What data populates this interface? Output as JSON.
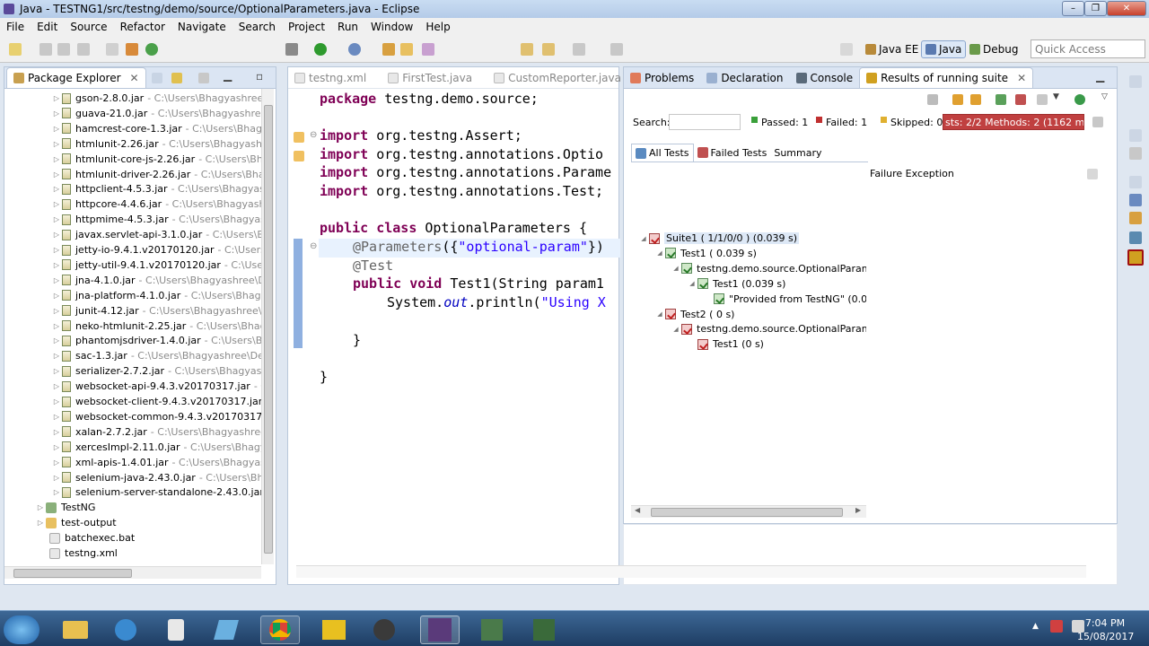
{
  "window": {
    "title": "Java - TESTNG1/src/testng/demo/source/OptionalParameters.java - Eclipse"
  },
  "menu": [
    "File",
    "Edit",
    "Source",
    "Refactor",
    "Navigate",
    "Search",
    "Project",
    "Run",
    "Window",
    "Help"
  ],
  "perspectives": {
    "java_ee": "Java EE",
    "java": "Java",
    "debug": "Debug"
  },
  "quick_access": {
    "placeholder": "Quick Access"
  },
  "package_explorer": {
    "title": "Package Explorer",
    "jars": [
      {
        "name": "gson-2.8.0.jar",
        "path": "- C:\\Users\\Bhagyashree\\De"
      },
      {
        "name": "guava-21.0.jar",
        "path": "- C:\\Users\\Bhagyashree\\D"
      },
      {
        "name": "hamcrest-core-1.3.jar",
        "path": "- C:\\Users\\Bhagya"
      },
      {
        "name": "htmlunit-2.26.jar",
        "path": "- C:\\Users\\Bhagyashree"
      },
      {
        "name": "htmlunit-core-js-2.26.jar",
        "path": "- C:\\Users\\Bhag"
      },
      {
        "name": "htmlunit-driver-2.26.jar",
        "path": "- C:\\Users\\Bhagy"
      },
      {
        "name": "httpclient-4.5.3.jar",
        "path": "- C:\\Users\\Bhagyashr"
      },
      {
        "name": "httpcore-4.4.6.jar",
        "path": "- C:\\Users\\Bhagyashree"
      },
      {
        "name": "httpmime-4.5.3.jar",
        "path": "- C:\\Users\\Bhagyashr"
      },
      {
        "name": "javax.servlet-api-3.1.0.jar",
        "path": "- C:\\Users\\Bhag"
      },
      {
        "name": "jetty-io-9.4.1.v20170120.jar",
        "path": "- C:\\Users\\Bh"
      },
      {
        "name": "jetty-util-9.4.1.v20170120.jar",
        "path": "- C:\\Users\\B"
      },
      {
        "name": "jna-4.1.0.jar",
        "path": "- C:\\Users\\Bhagyashree\\Des"
      },
      {
        "name": "jna-platform-4.1.0.jar",
        "path": "- C:\\Users\\Bhagyas"
      },
      {
        "name": "junit-4.12.jar",
        "path": "- C:\\Users\\Bhagyashree\\De"
      },
      {
        "name": "neko-htmlunit-2.25.jar",
        "path": "- C:\\Users\\Bhagy"
      },
      {
        "name": "phantomjsdriver-1.4.0.jar",
        "path": "- C:\\Users\\Bha"
      },
      {
        "name": "sac-1.3.jar",
        "path": "- C:\\Users\\Bhagyashree\\Deskt"
      },
      {
        "name": "serializer-2.7.2.jar",
        "path": "- C:\\Users\\Bhagyashree"
      },
      {
        "name": "websocket-api-9.4.3.v20170317.jar",
        "path": "- C:\\U"
      },
      {
        "name": "websocket-client-9.4.3.v20170317.jar",
        "path": "- C:"
      },
      {
        "name": "websocket-common-9.4.3.v20170317.jar",
        "path": ""
      },
      {
        "name": "xalan-2.7.2.jar",
        "path": "- C:\\Users\\Bhagyashree\\D"
      },
      {
        "name": "xercesImpl-2.11.0.jar",
        "path": "- C:\\Users\\Bhagyasl"
      },
      {
        "name": "xml-apis-1.4.01.jar",
        "path": "- C:\\Users\\Bhagyashr"
      },
      {
        "name": "selenium-java-2.43.0.jar",
        "path": "- C:\\Users\\Bhag"
      },
      {
        "name": "selenium-server-standalone-2.43.0.jar",
        "path": "- C"
      }
    ],
    "folders": [
      "TestNG",
      "test-output"
    ],
    "files": [
      "batchexec.bat",
      "testng.xml"
    ]
  },
  "editor": {
    "tabs": [
      "testng.xml",
      "FirstTest.java",
      "CustomReporter.java"
    ],
    "lines": [
      "package testng.demo.source;",
      "import org.testng.Assert;",
      "import org.testng.annotations.Optio",
      "import org.testng.annotations.Parame",
      "import org.testng.annotations.Test;",
      "public class OptionalParameters {",
      "@Parameters({\"optional-param\"})",
      "@Test",
      "public void Test1(String param1",
      "System.out.println(\"Using X",
      "}",
      "}"
    ]
  },
  "results": {
    "tabs": [
      "Problems",
      "Declaration",
      "Console",
      "Results of running suite"
    ],
    "search_label": "Search:",
    "passed": "Passed: 1",
    "failed": "Failed: 1",
    "skipped": "Skipped: 0",
    "progress_text": "sts: 2/2  Methods: 2 (1162 ms)",
    "progress_color": "#c04040",
    "subtabs": [
      "All Tests",
      "Failed Tests",
      "Summary"
    ],
    "failure_header": "Failure Exception",
    "tree": [
      "Suite1 ( 1/1/0/0 ) (0.039 s)",
      "Test1 ( 0.039 s)",
      "testng.demo.source.OptionalParamet",
      "Test1  (0.039 s)",
      "\"Provided from TestNG\"  (0.03",
      "Test2 ( 0 s)",
      "testng.demo.source.OptionalParamet",
      "Test1  (0 s)"
    ]
  },
  "clock": {
    "time": "7:04 PM",
    "date": "15/08/2017"
  }
}
